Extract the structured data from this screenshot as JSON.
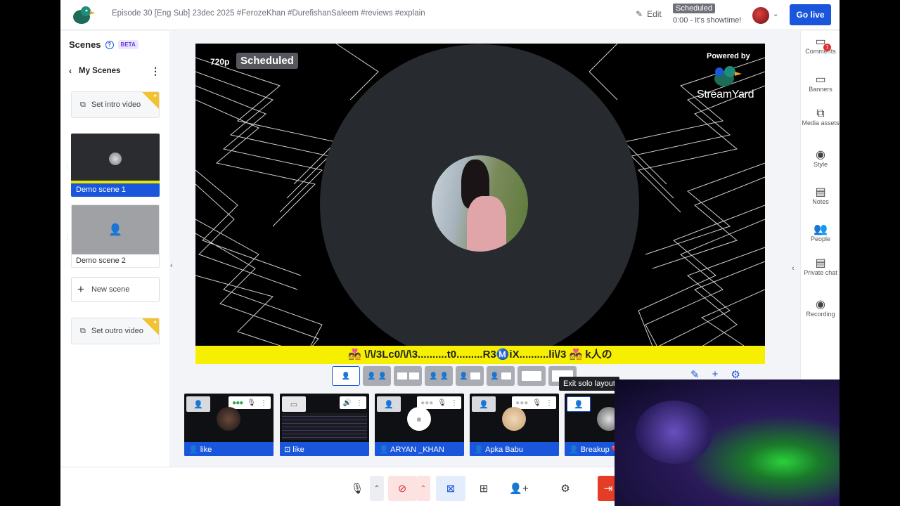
{
  "header": {
    "title": "Episode 30 [Eng Sub] 23dec 2025 #FerozeKhan #DurefishanSaleem #reviews #explain",
    "edit_label": "Edit",
    "status_badge": "Scheduled",
    "showtime": "0:00 - It's showtime!",
    "go_live": "Go live"
  },
  "sidebar": {
    "title": "Scenes",
    "help": "?",
    "beta": "BETA",
    "my_scenes": "My Scenes",
    "intro_video": "Set intro video",
    "scenes": [
      {
        "label": "Demo scene 1",
        "active": true
      },
      {
        "label": "Demo scene 2",
        "active": false
      }
    ],
    "new_scene": "New scene",
    "outro_video": "Set outro video"
  },
  "stage": {
    "resolution": "720p",
    "status": "Scheduled",
    "powered_by": "Powered by",
    "brand": "StreamYard",
    "ticker": "💑 \\/\\/3Lc0/\\/\\3..........t0.........R3Ⓜ️iX..........li\\/3 💑 k人の",
    "ticker_color": "#f6f000"
  },
  "tooltip": "Exit solo layout",
  "participants": [
    {
      "name": "like",
      "type": "camera"
    },
    {
      "name": "like",
      "type": "screen"
    },
    {
      "name": "ARYAN _KHAN",
      "type": "camera"
    },
    {
      "name": "Apka Babu",
      "type": "camera"
    },
    {
      "name": "Breakup 💔",
      "type": "camera"
    }
  ],
  "right_rail": {
    "comments": "Comments",
    "comments_count": "1",
    "banners": "Banners",
    "media_assets": "Media assets",
    "style": "Style",
    "notes": "Notes",
    "people": "People",
    "private_chat": "Private chat",
    "recording": "Recording"
  },
  "colors": {
    "accent": "#1a56db",
    "leave": "#e53c25"
  }
}
